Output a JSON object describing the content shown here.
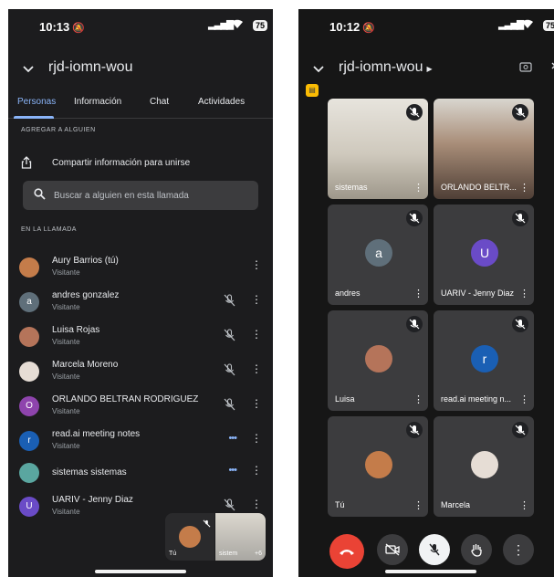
{
  "left_screen": {
    "status": {
      "time": "10:13",
      "battery": "75"
    },
    "meeting_title": "rjd-iomn-wou",
    "tabs": [
      {
        "label": "Personas",
        "active": true
      },
      {
        "label": "Información",
        "active": false
      },
      {
        "label": "Chat",
        "active": false
      },
      {
        "label": "Actividades",
        "active": false
      }
    ],
    "add_section_label": "AGREGAR A ALGUIEN",
    "share_label": "Compartir información para unirse",
    "search_placeholder": "Buscar a alguien en esta llamada",
    "in_call_label": "EN LA LLAMADA",
    "participants": [
      {
        "name": "Aury Barrios (tú)",
        "role": "Visitante",
        "avatar": "photo",
        "avatar_color": "#c47c4a",
        "status": "none"
      },
      {
        "name": "andres gonzalez",
        "role": "Visitante",
        "avatar": "a",
        "avatar_color": "#5f6f7a",
        "status": "muted"
      },
      {
        "name": "Luisa Rojas",
        "role": "Visitante",
        "avatar": "photo",
        "avatar_color": "#b5745a",
        "status": "muted"
      },
      {
        "name": "Marcela Moreno",
        "role": "Visitante",
        "avatar": "photo",
        "avatar_color": "#e6ddd5",
        "status": "muted"
      },
      {
        "name": "ORLANDO BELTRAN RODRIGUEZ",
        "role": "Visitante",
        "avatar": "O",
        "avatar_color": "#8e44ad",
        "status": "muted"
      },
      {
        "name": "read.ai meeting notes",
        "role": "Visitante",
        "avatar": "r",
        "avatar_color": "#1a5fb4",
        "status": "speaking"
      },
      {
        "name": "sistemas sistemas",
        "role": "",
        "avatar": "photo",
        "avatar_color": "#5aa6a0",
        "status": "speaking"
      },
      {
        "name": "UARIV - Jenny Diaz",
        "role": "Visitante",
        "avatar": "U",
        "avatar_color": "#6a4bc7",
        "status": "muted"
      }
    ],
    "pip": {
      "me_label": "Tú",
      "other_label": "sistem",
      "extra_count": "+6"
    }
  },
  "right_screen": {
    "status": {
      "time": "10:12",
      "battery": "75"
    },
    "meeting_title": "rjd-iomn-wou",
    "tiles": [
      {
        "name": "sistemas",
        "type": "photo",
        "avatar": "",
        "avatar_color": "#bfb9ae"
      },
      {
        "name": "ORLANDO BELTR...",
        "type": "photo",
        "avatar": "",
        "avatar_color": "#6b5a4d"
      },
      {
        "name": "andres",
        "type": "letter",
        "avatar": "a",
        "avatar_color": "#5f6f7a"
      },
      {
        "name": "UARIV - Jenny Diaz",
        "type": "letter",
        "avatar": "U",
        "avatar_color": "#6a4bc7"
      },
      {
        "name": "Luisa",
        "type": "avatar-photo",
        "avatar": "",
        "avatar_color": "#b5745a"
      },
      {
        "name": "read.ai meeting n...",
        "type": "letter",
        "avatar": "r",
        "avatar_color": "#1a5fb4"
      },
      {
        "name": "Tú",
        "type": "avatar-photo",
        "avatar": "",
        "avatar_color": "#c47c4a"
      },
      {
        "name": "Marcela",
        "type": "avatar-photo",
        "avatar": "",
        "avatar_color": "#e6ddd5"
      }
    ],
    "accent": "#8ab4f8",
    "end_call_color": "#ea4335"
  }
}
